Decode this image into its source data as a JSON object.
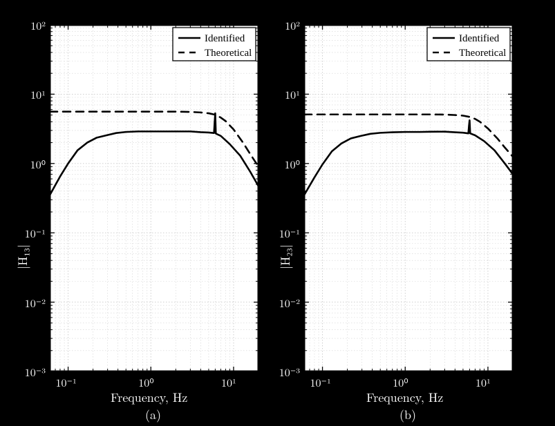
{
  "chart_data": [
    {
      "id": "left",
      "type": "line",
      "title": "",
      "xlabel": "Frequency, Hz",
      "ylabel": "|H₁₃|",
      "subplot_label": "(a)",
      "xscale": "log",
      "yscale": "log",
      "xlim": [
        0.06,
        20
      ],
      "ylim": [
        0.001,
        100
      ],
      "xticks": [
        0.1,
        1,
        10
      ],
      "yticks": [
        0.001,
        0.01,
        0.1,
        1,
        10,
        100
      ],
      "ytick_labels": [
        "10⁻³",
        "10⁻²",
        "10⁻¹",
        "10⁰",
        "10¹",
        "10²"
      ],
      "xtick_labels": [
        "10⁻¹",
        "10⁰",
        "10¹"
      ],
      "legend": {
        "position": "top-right",
        "entries": [
          "Identified",
          "Theoretical"
        ]
      },
      "series": [
        {
          "name": "Identified",
          "style": "solid",
          "x": [
            0.06,
            0.08,
            0.1,
            0.13,
            0.17,
            0.22,
            0.29,
            0.38,
            0.5,
            0.7,
            1.0,
            1.5,
            2.0,
            3.0,
            4.0,
            5.0,
            5.8,
            5.9,
            6.0,
            6.1,
            7.0,
            9.0,
            12.0,
            16.0,
            20.0
          ],
          "y": [
            0.35,
            0.65,
            1.0,
            1.55,
            2.0,
            2.35,
            2.55,
            2.75,
            2.85,
            2.9,
            2.9,
            2.9,
            2.9,
            2.9,
            2.83,
            2.8,
            2.75,
            3.9,
            5.3,
            2.7,
            2.5,
            1.9,
            1.3,
            0.75,
            0.47
          ]
        },
        {
          "name": "Theoretical",
          "style": "dash",
          "x": [
            0.06,
            0.1,
            0.2,
            0.5,
            1.0,
            2.0,
            3.0,
            4.0,
            5.0,
            6.0,
            7.0,
            8.0,
            10.0,
            13.0,
            16.0,
            20.0
          ],
          "y": [
            5.6,
            5.6,
            5.6,
            5.6,
            5.6,
            5.6,
            5.55,
            5.45,
            5.3,
            5.05,
            4.6,
            4.1,
            3.1,
            2.0,
            1.35,
            0.9
          ]
        }
      ]
    },
    {
      "id": "right",
      "type": "line",
      "title": "",
      "xlabel": "Frequency, Hz",
      "ylabel": "|H₂₃|",
      "subplot_label": "(b)",
      "xscale": "log",
      "yscale": "log",
      "xlim": [
        0.06,
        20
      ],
      "ylim": [
        0.001,
        100
      ],
      "xticks": [
        0.1,
        1,
        10
      ],
      "yticks": [
        0.001,
        0.01,
        0.1,
        1,
        10,
        100
      ],
      "ytick_labels": [
        "10⁻³",
        "10⁻²",
        "10⁻¹",
        "10⁰",
        "10¹",
        "10²"
      ],
      "xtick_labels": [
        "10⁻¹",
        "10⁰",
        "10¹"
      ],
      "legend": {
        "position": "top-right",
        "entries": [
          "Identified",
          "Theoretical"
        ]
      },
      "series": [
        {
          "name": "Identified",
          "style": "solid",
          "x": [
            0.06,
            0.08,
            0.1,
            0.13,
            0.17,
            0.22,
            0.29,
            0.38,
            0.5,
            0.7,
            1.0,
            1.5,
            2.0,
            3.0,
            4.0,
            5.0,
            5.8,
            5.9,
            6.0,
            6.1,
            7.0,
            9.0,
            12.0,
            16.0,
            20.0
          ],
          "y": [
            0.35,
            0.63,
            0.97,
            1.5,
            1.95,
            2.3,
            2.5,
            2.68,
            2.77,
            2.82,
            2.85,
            2.85,
            2.87,
            2.88,
            2.82,
            2.78,
            2.72,
            3.5,
            4.2,
            2.72,
            2.55,
            2.1,
            1.55,
            1.0,
            0.7
          ]
        },
        {
          "name": "Theoretical",
          "style": "dash",
          "x": [
            0.06,
            0.1,
            0.2,
            0.5,
            1.0,
            2.0,
            3.0,
            4.0,
            5.0,
            6.0,
            7.0,
            8.0,
            10.0,
            13.0,
            16.0,
            20.0
          ],
          "y": [
            5.1,
            5.1,
            5.1,
            5.1,
            5.1,
            5.1,
            5.08,
            5.0,
            4.9,
            4.7,
            4.4,
            4.0,
            3.2,
            2.3,
            1.7,
            1.25
          ]
        }
      ]
    }
  ]
}
